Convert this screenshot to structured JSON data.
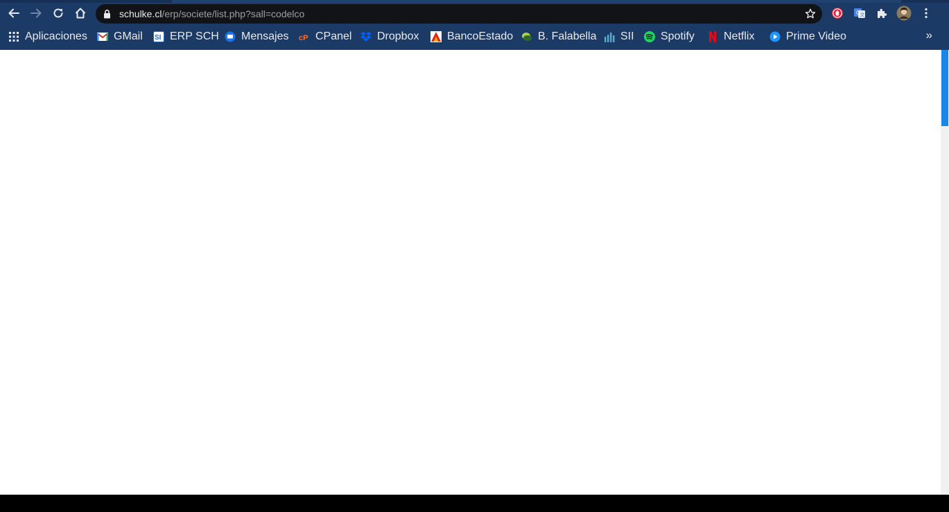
{
  "browser": {
    "url": {
      "host": "schulke.cl",
      "path": "/erp/societe/list.php?sall=codelco"
    },
    "accent_color": "#1c3a66",
    "nav_icons": [
      "back-icon",
      "forward-icon",
      "reload-icon",
      "home-icon"
    ],
    "extension_icons": [
      "adblock-icon",
      "google-translate-icon",
      "extensions-puzzle-icon",
      "profile-avatar",
      "menu-dots-icon"
    ]
  },
  "bookmarks": {
    "items": [
      {
        "label": "Aplicaciones",
        "icon": "apps-grid-icon"
      },
      {
        "label": "GMail",
        "icon": "gmail-icon"
      },
      {
        "label": "ERP SCH",
        "icon": "erp-icon"
      },
      {
        "label": "Mensajes",
        "icon": "messages-icon"
      },
      {
        "label": "CPanel",
        "icon": "cpanel-icon"
      },
      {
        "label": "Dropbox",
        "icon": "dropbox-icon"
      },
      {
        "label": "BancoEstado",
        "icon": "bancoestado-icon"
      },
      {
        "label": "B. Falabella",
        "icon": "falabella-icon"
      },
      {
        "label": "SII",
        "icon": "sii-icon"
      },
      {
        "label": "Spotify",
        "icon": "spotify-icon"
      },
      {
        "label": "Netflix",
        "icon": "netflix-icon"
      },
      {
        "label": "Prime Video",
        "icon": "primevideo-icon"
      }
    ],
    "overflow": "»"
  },
  "page": {
    "background": "#ffffff",
    "scrollbar_thumb_color": "#1a86e8"
  }
}
